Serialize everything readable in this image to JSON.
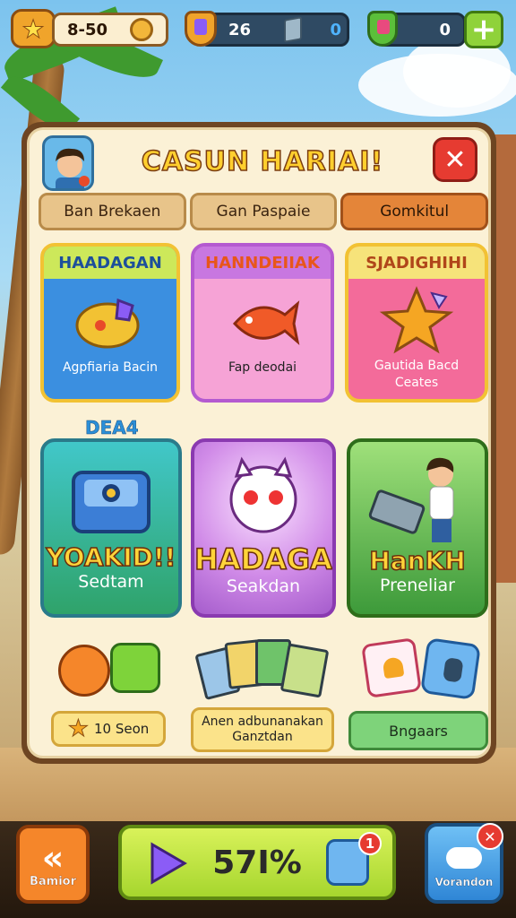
{
  "topbar": {
    "level_value": "8-50",
    "gems_value": "26",
    "crystals_value": "0",
    "shields_value": "0",
    "add_label": "+"
  },
  "panel": {
    "title": "CASUN HARIAI!",
    "close_label": "✕",
    "tabs": [
      {
        "label": "Ban Brekaen"
      },
      {
        "label": "Gan Paspaie"
      },
      {
        "label": "Gomkitul"
      }
    ],
    "cards_top": [
      {
        "header": "HAADAGAN",
        "caption": "Agpfiaria Bacin"
      },
      {
        "header": "HANNDEIIAK",
        "caption": "Fap deodai"
      },
      {
        "header": "SJADIGHIHI",
        "caption": "Gautida Bacd\nCeates"
      }
    ],
    "deal_label": "DEA4",
    "cards_big": [
      {
        "title": "YOAKID!!",
        "sub": "Sedtam"
      },
      {
        "title": "HADAGAH",
        "sub": "Seakdan"
      },
      {
        "title": "HanKH",
        "sub": "Preneliar"
      }
    ],
    "items": [
      {
        "label": "10 Seon"
      },
      {
        "label": "Anen adbunanakan\nGanztdan"
      },
      {
        "label": "Bngaars"
      }
    ]
  },
  "bottom": {
    "back_label": "Bamior",
    "play_label": "57I%",
    "notif_count": "1",
    "right_label": "Vorandon",
    "right_badge": "✕"
  },
  "colors": {
    "accent_gold": "#ffcf2e",
    "close_red": "#e63b31",
    "play_green": "#b5e43c",
    "panel_cream": "#fbf1d6"
  }
}
